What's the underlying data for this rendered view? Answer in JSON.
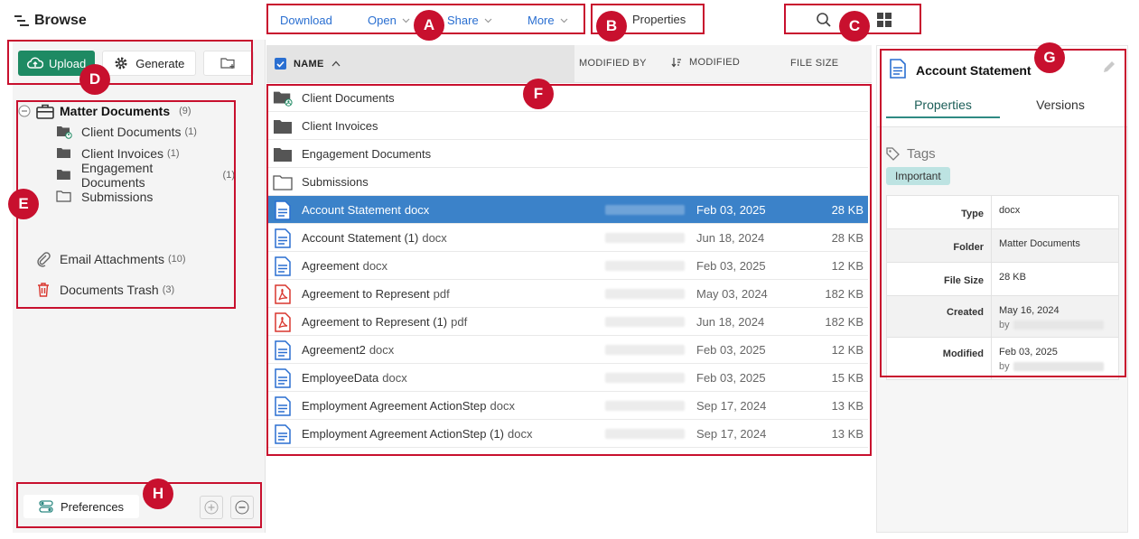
{
  "header": {
    "browse_label": "Browse"
  },
  "toolbar": {
    "download": "Download",
    "open": "Open",
    "share": "Share",
    "more": "More",
    "properties": "Properties"
  },
  "actions": {
    "upload": "Upload",
    "generate": "Generate"
  },
  "tree": {
    "root": {
      "label": "Matter Documents",
      "count": "(9)"
    },
    "children": [
      {
        "label": "Client Documents",
        "count": "(1)"
      },
      {
        "label": "Client Invoices",
        "count": "(1)"
      },
      {
        "label": "Engagement Documents",
        "count": "(1)"
      },
      {
        "label": "Submissions",
        "count": ""
      }
    ],
    "extras": [
      {
        "label": "Email Attachments",
        "count": "(10)"
      },
      {
        "label": "Documents Trash",
        "count": "(3)"
      }
    ]
  },
  "footer": {
    "preferences": "Preferences"
  },
  "table": {
    "columns": {
      "name": "NAME",
      "modified_by": "MODIFIED BY",
      "modified": "MODIFIED",
      "file_size": "FILE SIZE"
    },
    "rows": [
      {
        "name": "Client Documents",
        "ext": "",
        "date": "",
        "size": "",
        "icon": "folder-shared-icon"
      },
      {
        "name": "Client Invoices",
        "ext": "",
        "date": "",
        "size": "",
        "icon": "folder-icon"
      },
      {
        "name": "Engagement Documents",
        "ext": "",
        "date": "",
        "size": "",
        "icon": "folder-icon"
      },
      {
        "name": "Submissions",
        "ext": "",
        "date": "",
        "size": "",
        "icon": "folder-outline-icon"
      },
      {
        "name": "Account Statement",
        "ext": "docx",
        "date": "Feb 03, 2025",
        "size": "28 KB",
        "icon": "docx-icon"
      },
      {
        "name": "Account Statement (1)",
        "ext": "docx",
        "date": "Jun 18, 2024",
        "size": "28 KB",
        "icon": "docx-icon"
      },
      {
        "name": "Agreement",
        "ext": "docx",
        "date": "Feb 03, 2025",
        "size": "12 KB",
        "icon": "docx-icon"
      },
      {
        "name": "Agreement to Represent",
        "ext": "pdf",
        "date": "May 03, 2024",
        "size": "182 KB",
        "icon": "pdf-icon"
      },
      {
        "name": "Agreement to Represent (1)",
        "ext": "pdf",
        "date": "Jun 18, 2024",
        "size": "182 KB",
        "icon": "pdf-icon"
      },
      {
        "name": "Agreement2",
        "ext": "docx",
        "date": "Feb 03, 2025",
        "size": "12 KB",
        "icon": "docx-icon"
      },
      {
        "name": "EmployeeData",
        "ext": "docx",
        "date": "Feb 03, 2025",
        "size": "15 KB",
        "icon": "docx-icon"
      },
      {
        "name": "Employment Agreement ActionStep",
        "ext": "docx",
        "date": "Sep 17, 2024",
        "size": "13 KB",
        "icon": "docx-icon"
      },
      {
        "name": "Employment Agreement ActionStep (1)",
        "ext": "docx",
        "date": "Sep 17, 2024",
        "size": "13 KB",
        "icon": "docx-icon"
      }
    ]
  },
  "props": {
    "title": "Account Statement",
    "tab_properties": "Properties",
    "tab_versions": "Versions",
    "tags_label": "Tags",
    "tag": "Important",
    "rows": [
      {
        "k": "Type",
        "v": "docx"
      },
      {
        "k": "Folder",
        "v": "Matter Documents"
      },
      {
        "k": "File Size",
        "v": "28 KB"
      },
      {
        "k": "Created",
        "v": "May 16, 2024"
      },
      {
        "k": "Modified",
        "v": "Feb 03, 2025"
      }
    ],
    "by": "by"
  },
  "badges": {
    "a": "A",
    "b": "B",
    "c": "C",
    "d": "D",
    "e": "E",
    "f": "F",
    "g": "G",
    "h": "H"
  },
  "colors": {
    "accent_blue": "#2a6fd1",
    "upload_green": "#1e8a63",
    "selected_row": "#3b82c9",
    "annotation_red": "#c8102e",
    "tag_teal": "#bde3e2"
  }
}
